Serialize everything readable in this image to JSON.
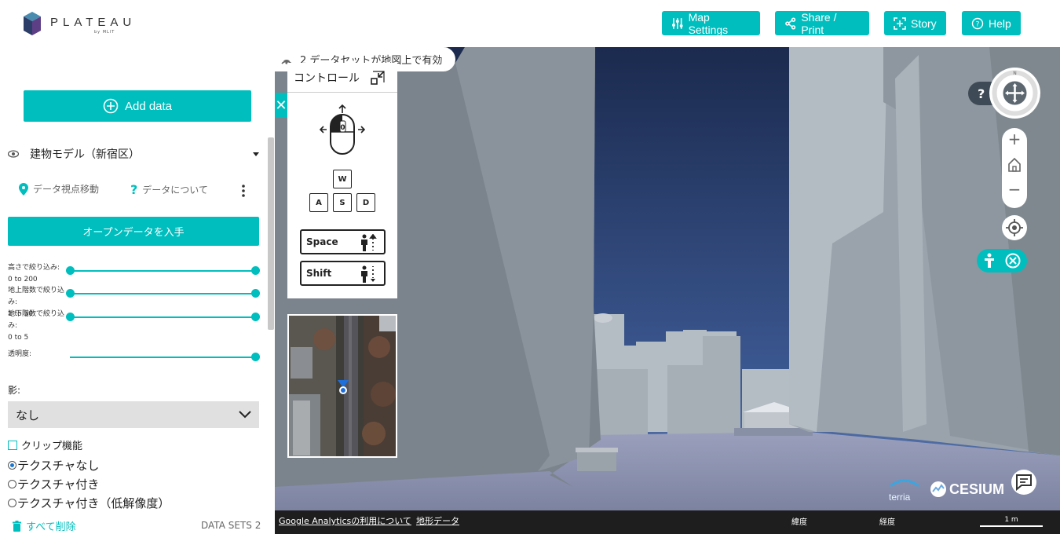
{
  "header": {
    "logo_text": "PLATEAU",
    "logo_sub": "by MLIT",
    "buttons": [
      {
        "label": "Map Settings",
        "icon": "sliders-icon"
      },
      {
        "label": "Share / Print",
        "icon": "share-icon"
      },
      {
        "label": "Story",
        "icon": "story-icon"
      },
      {
        "label": "Help",
        "icon": "help-icon"
      }
    ]
  },
  "sidebar": {
    "add_data_label": "Add data",
    "layer": {
      "title": "建物モデル（新宿区）",
      "zoom_to_label": "データ視点移動",
      "about_label": "データについて"
    },
    "open_data_label": "オープンデータを入手",
    "filters": [
      {
        "label": "高さで絞り込み:",
        "range_text": "0 to 200",
        "min_fraction": 0,
        "max_fraction": 1
      },
      {
        "label": "地上階数で絞り込み:",
        "range_text": "1 to 50",
        "min_fraction": 0,
        "max_fraction": 1
      },
      {
        "label": "地下階数で絞り込み:",
        "range_text": "0 to 5",
        "min_fraction": 0,
        "max_fraction": 1
      }
    ],
    "opacity_label": "透明度:",
    "opacity_fraction": 1,
    "shadow_label": "影:",
    "shadow_value": "なし",
    "clip_label": "クリップ機能",
    "texture_options": [
      {
        "label": "テクスチャなし",
        "checked": true
      },
      {
        "label": "テクスチャ付き",
        "checked": false
      },
      {
        "label": "テクスチャ付き（低解像度）",
        "checked": false
      }
    ],
    "delete_all_label": "すべて削除",
    "datasets_count_label": "DATA SETS 2"
  },
  "map": {
    "datasets_pill": "2 データセットが地図上で有効",
    "controls_title": "コントロール",
    "keys": [
      "W",
      "A",
      "S",
      "D"
    ],
    "mouse_key": "0",
    "space_label": "Space",
    "shift_label": "Shift",
    "zoom_in": "+",
    "zoom_out": "−",
    "help_symbol": "?",
    "compass_north": "N",
    "brand_terria": "terria",
    "brand_cesium": "CESIUM",
    "bottom": {
      "analytics_link": "Google Analyticsの利用について",
      "terrain_link": "地形データ",
      "lat_label": "緯度",
      "lon_label": "経度",
      "scale_label": "1 m"
    }
  },
  "colors": {
    "accent": "#00bebe",
    "sky_top": "#1b2a4e",
    "sky_bottom": "#5a7ab0",
    "building": "#9aa4ad",
    "ground": "#8088a6"
  }
}
